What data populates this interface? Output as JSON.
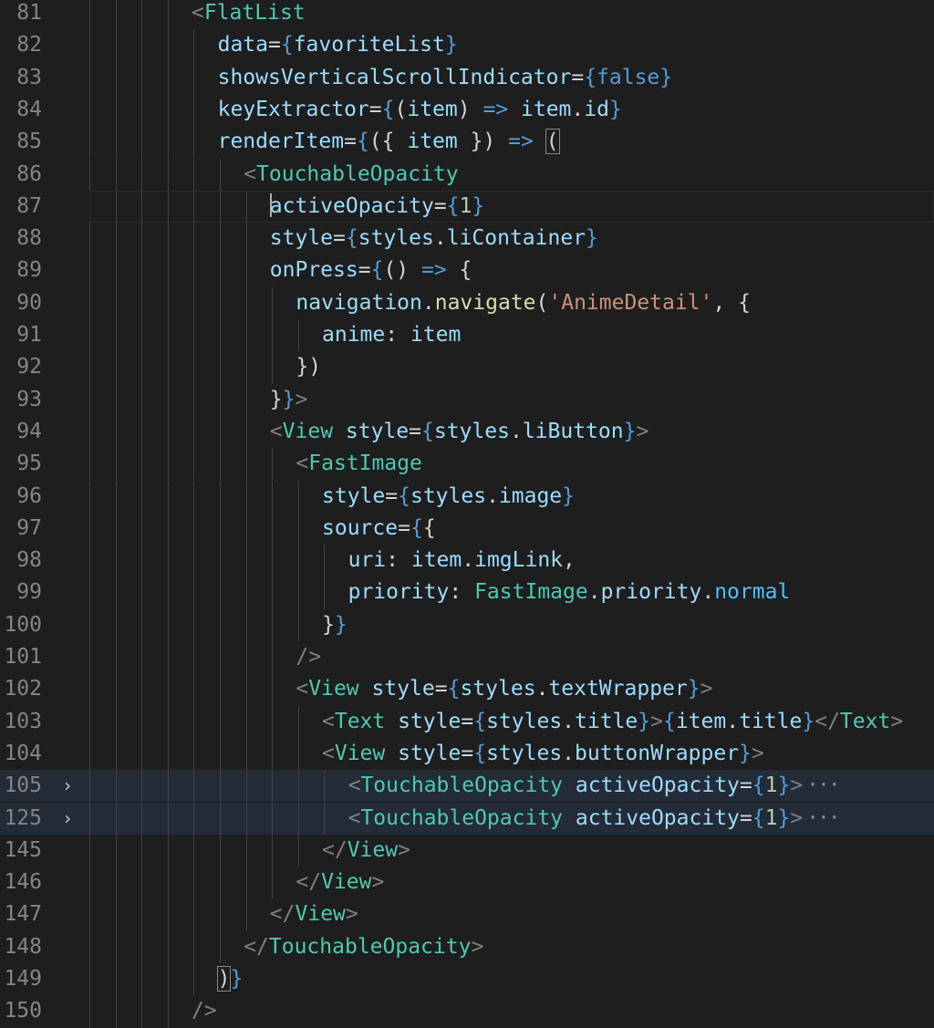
{
  "editor": {
    "lines": [
      {
        "num": "81",
        "indent": 7,
        "tokens": [
          [
            "t-punct",
            "<"
          ],
          [
            "t-tag",
            "FlatList"
          ]
        ]
      },
      {
        "num": "82",
        "indent": 8,
        "tokens": [
          [
            "t-attr",
            "data"
          ],
          [
            "t-plain",
            "="
          ],
          [
            "t-brace",
            "{"
          ],
          [
            "t-ident",
            "favoriteList"
          ],
          [
            "t-brace",
            "}"
          ]
        ]
      },
      {
        "num": "83",
        "indent": 8,
        "tokens": [
          [
            "t-attr",
            "showsVerticalScrollIndicator"
          ],
          [
            "t-plain",
            "="
          ],
          [
            "t-brace",
            "{"
          ],
          [
            "t-kw",
            "false"
          ],
          [
            "t-brace",
            "}"
          ]
        ]
      },
      {
        "num": "84",
        "indent": 8,
        "tokens": [
          [
            "t-attr",
            "keyExtractor"
          ],
          [
            "t-plain",
            "="
          ],
          [
            "t-brace",
            "{"
          ],
          [
            "t-plain",
            "("
          ],
          [
            "t-ident",
            "item"
          ],
          [
            "t-plain",
            ") "
          ],
          [
            "t-kw",
            "=>"
          ],
          [
            "t-plain",
            " "
          ],
          [
            "t-ident",
            "item"
          ],
          [
            "t-plain",
            "."
          ],
          [
            "t-prop",
            "id"
          ],
          [
            "t-brace",
            "}"
          ]
        ]
      },
      {
        "num": "85",
        "indent": 8,
        "tokens": [
          [
            "t-attr",
            "renderItem"
          ],
          [
            "t-plain",
            "="
          ],
          [
            "t-brace",
            "{"
          ],
          [
            "t-plain",
            "({ "
          ],
          [
            "t-ident",
            "item"
          ],
          [
            "t-plain",
            " }) "
          ],
          [
            "t-kw",
            "=>"
          ],
          [
            "t-plain",
            " "
          ],
          [
            "t-plain",
            "("
          ]
        ],
        "boxLast": true
      },
      {
        "num": "86",
        "indent": 9,
        "tokens": [
          [
            "t-punct",
            "<"
          ],
          [
            "t-tag",
            "TouchableOpacity"
          ]
        ]
      },
      {
        "num": "87",
        "indent": 10,
        "tokens": [
          [
            "t-attr",
            "activeOpacity"
          ],
          [
            "t-plain",
            "="
          ],
          [
            "t-brace",
            "{"
          ],
          [
            "t-num",
            "1"
          ],
          [
            "t-brace",
            "}"
          ]
        ],
        "cursor": true,
        "current": true
      },
      {
        "num": "88",
        "indent": 10,
        "tokens": [
          [
            "t-attr",
            "style"
          ],
          [
            "t-plain",
            "="
          ],
          [
            "t-brace",
            "{"
          ],
          [
            "t-ident",
            "styles"
          ],
          [
            "t-plain",
            "."
          ],
          [
            "t-prop",
            "liContainer"
          ],
          [
            "t-brace",
            "}"
          ]
        ]
      },
      {
        "num": "89",
        "indent": 10,
        "tokens": [
          [
            "t-attr",
            "onPress"
          ],
          [
            "t-plain",
            "="
          ],
          [
            "t-brace",
            "{"
          ],
          [
            "t-plain",
            "() "
          ],
          [
            "t-kw",
            "=>"
          ],
          [
            "t-plain",
            " {"
          ]
        ]
      },
      {
        "num": "90",
        "indent": 11,
        "tokens": [
          [
            "t-ident",
            "navigation"
          ],
          [
            "t-plain",
            "."
          ],
          [
            "t-fn",
            "navigate"
          ],
          [
            "t-plain",
            "("
          ],
          [
            "t-str",
            "'AnimeDetail'"
          ],
          [
            "t-plain",
            ", {"
          ]
        ]
      },
      {
        "num": "91",
        "indent": 12,
        "tokens": [
          [
            "t-prop",
            "anime"
          ],
          [
            "t-plain",
            ": "
          ],
          [
            "t-ident",
            "item"
          ]
        ]
      },
      {
        "num": "92",
        "indent": 11,
        "tokens": [
          [
            "t-plain",
            "})"
          ]
        ]
      },
      {
        "num": "93",
        "indent": 10,
        "tokens": [
          [
            "t-plain",
            "}"
          ],
          [
            "t-brace",
            "}"
          ],
          [
            "t-punct",
            ">"
          ]
        ]
      },
      {
        "num": "94",
        "indent": 10,
        "tokens": [
          [
            "t-punct",
            "<"
          ],
          [
            "t-tag",
            "View"
          ],
          [
            "t-plain",
            " "
          ],
          [
            "t-attr",
            "style"
          ],
          [
            "t-plain",
            "="
          ],
          [
            "t-brace",
            "{"
          ],
          [
            "t-ident",
            "styles"
          ],
          [
            "t-plain",
            "."
          ],
          [
            "t-prop",
            "liButton"
          ],
          [
            "t-brace",
            "}"
          ],
          [
            "t-punct",
            ">"
          ]
        ]
      },
      {
        "num": "95",
        "indent": 11,
        "tokens": [
          [
            "t-punct",
            "<"
          ],
          [
            "t-tag",
            "FastImage"
          ]
        ]
      },
      {
        "num": "96",
        "indent": 12,
        "tokens": [
          [
            "t-attr",
            "style"
          ],
          [
            "t-plain",
            "="
          ],
          [
            "t-brace",
            "{"
          ],
          [
            "t-ident",
            "styles"
          ],
          [
            "t-plain",
            "."
          ],
          [
            "t-prop",
            "image"
          ],
          [
            "t-brace",
            "}"
          ]
        ]
      },
      {
        "num": "97",
        "indent": 12,
        "tokens": [
          [
            "t-attr",
            "source"
          ],
          [
            "t-plain",
            "="
          ],
          [
            "t-brace",
            "{"
          ],
          [
            "t-plain",
            "{"
          ]
        ]
      },
      {
        "num": "98",
        "indent": 13,
        "tokens": [
          [
            "t-prop",
            "uri"
          ],
          [
            "t-plain",
            ": "
          ],
          [
            "t-ident",
            "item"
          ],
          [
            "t-plain",
            "."
          ],
          [
            "t-prop",
            "imgLink"
          ],
          [
            "t-plain",
            ","
          ]
        ]
      },
      {
        "num": "99",
        "indent": 13,
        "tokens": [
          [
            "t-prop",
            "priority"
          ],
          [
            "t-plain",
            ": "
          ],
          [
            "t-cls",
            "FastImage"
          ],
          [
            "t-plain",
            "."
          ],
          [
            "t-prop",
            "priority"
          ],
          [
            "t-plain",
            "."
          ],
          [
            "t-const",
            "normal"
          ]
        ]
      },
      {
        "num": "100",
        "indent": 12,
        "tokens": [
          [
            "t-plain",
            "}"
          ],
          [
            "t-brace",
            "}"
          ]
        ]
      },
      {
        "num": "101",
        "indent": 11,
        "tokens": [
          [
            "t-punct",
            "/>"
          ]
        ]
      },
      {
        "num": "102",
        "indent": 11,
        "tokens": [
          [
            "t-punct",
            "<"
          ],
          [
            "t-tag",
            "View"
          ],
          [
            "t-plain",
            " "
          ],
          [
            "t-attr",
            "style"
          ],
          [
            "t-plain",
            "="
          ],
          [
            "t-brace",
            "{"
          ],
          [
            "t-ident",
            "styles"
          ],
          [
            "t-plain",
            "."
          ],
          [
            "t-prop",
            "textWrapper"
          ],
          [
            "t-brace",
            "}"
          ],
          [
            "t-punct",
            ">"
          ]
        ]
      },
      {
        "num": "103",
        "indent": 12,
        "tokens": [
          [
            "t-punct",
            "<"
          ],
          [
            "t-tag",
            "Text"
          ],
          [
            "t-plain",
            " "
          ],
          [
            "t-attr",
            "style"
          ],
          [
            "t-plain",
            "="
          ],
          [
            "t-brace",
            "{"
          ],
          [
            "t-ident",
            "styles"
          ],
          [
            "t-plain",
            "."
          ],
          [
            "t-prop",
            "title"
          ],
          [
            "t-brace",
            "}"
          ],
          [
            "t-punct",
            ">"
          ],
          [
            "t-brace",
            "{"
          ],
          [
            "t-ident",
            "item"
          ],
          [
            "t-plain",
            "."
          ],
          [
            "t-prop",
            "title"
          ],
          [
            "t-brace",
            "}"
          ],
          [
            "t-punct",
            "</"
          ],
          [
            "t-tag",
            "Text"
          ],
          [
            "t-punct",
            ">"
          ]
        ]
      },
      {
        "num": "104",
        "indent": 12,
        "tokens": [
          [
            "t-punct",
            "<"
          ],
          [
            "t-tag",
            "View"
          ],
          [
            "t-plain",
            " "
          ],
          [
            "t-attr",
            "style"
          ],
          [
            "t-plain",
            "="
          ],
          [
            "t-brace",
            "{"
          ],
          [
            "t-ident",
            "styles"
          ],
          [
            "t-plain",
            "."
          ],
          [
            "t-prop",
            "buttonWrapper"
          ],
          [
            "t-brace",
            "}"
          ],
          [
            "t-punct",
            ">"
          ]
        ]
      },
      {
        "num": "105",
        "indent": 13,
        "tokens": [
          [
            "t-punct",
            "<"
          ],
          [
            "t-tag",
            "TouchableOpacity"
          ],
          [
            "t-plain",
            " "
          ],
          [
            "t-attr",
            "activeOpacity"
          ],
          [
            "t-plain",
            "="
          ],
          [
            "t-brace",
            "{"
          ],
          [
            "t-num",
            "1"
          ],
          [
            "t-brace",
            "}"
          ],
          [
            "t-punct",
            ">"
          ]
        ],
        "folded": true
      },
      {
        "num": "125",
        "indent": 13,
        "tokens": [
          [
            "t-punct",
            "<"
          ],
          [
            "t-tag",
            "TouchableOpacity"
          ],
          [
            "t-plain",
            " "
          ],
          [
            "t-attr",
            "activeOpacity"
          ],
          [
            "t-plain",
            "="
          ],
          [
            "t-brace",
            "{"
          ],
          [
            "t-num",
            "1"
          ],
          [
            "t-brace",
            "}"
          ],
          [
            "t-punct",
            ">"
          ]
        ],
        "folded": true
      },
      {
        "num": "145",
        "indent": 12,
        "tokens": [
          [
            "t-punct",
            "</"
          ],
          [
            "t-tag",
            "View"
          ],
          [
            "t-punct",
            ">"
          ]
        ]
      },
      {
        "num": "146",
        "indent": 11,
        "tokens": [
          [
            "t-punct",
            "</"
          ],
          [
            "t-tag",
            "View"
          ],
          [
            "t-punct",
            ">"
          ]
        ]
      },
      {
        "num": "147",
        "indent": 10,
        "tokens": [
          [
            "t-punct",
            "</"
          ],
          [
            "t-tag",
            "View"
          ],
          [
            "t-punct",
            ">"
          ]
        ]
      },
      {
        "num": "148",
        "indent": 9,
        "tokens": [
          [
            "t-punct",
            "</"
          ],
          [
            "t-tag",
            "TouchableOpacity"
          ],
          [
            "t-punct",
            ">"
          ]
        ]
      },
      {
        "num": "149",
        "indent": 8,
        "tokens": [
          [
            "t-plain",
            ")"
          ],
          [
            "t-brace",
            "}"
          ]
        ],
        "boxFirst": true
      },
      {
        "num": "150",
        "indent": 7,
        "tokens": [
          [
            "t-punct",
            "/>"
          ]
        ]
      }
    ],
    "fold_glyph": "›",
    "ellipsis": "···"
  }
}
